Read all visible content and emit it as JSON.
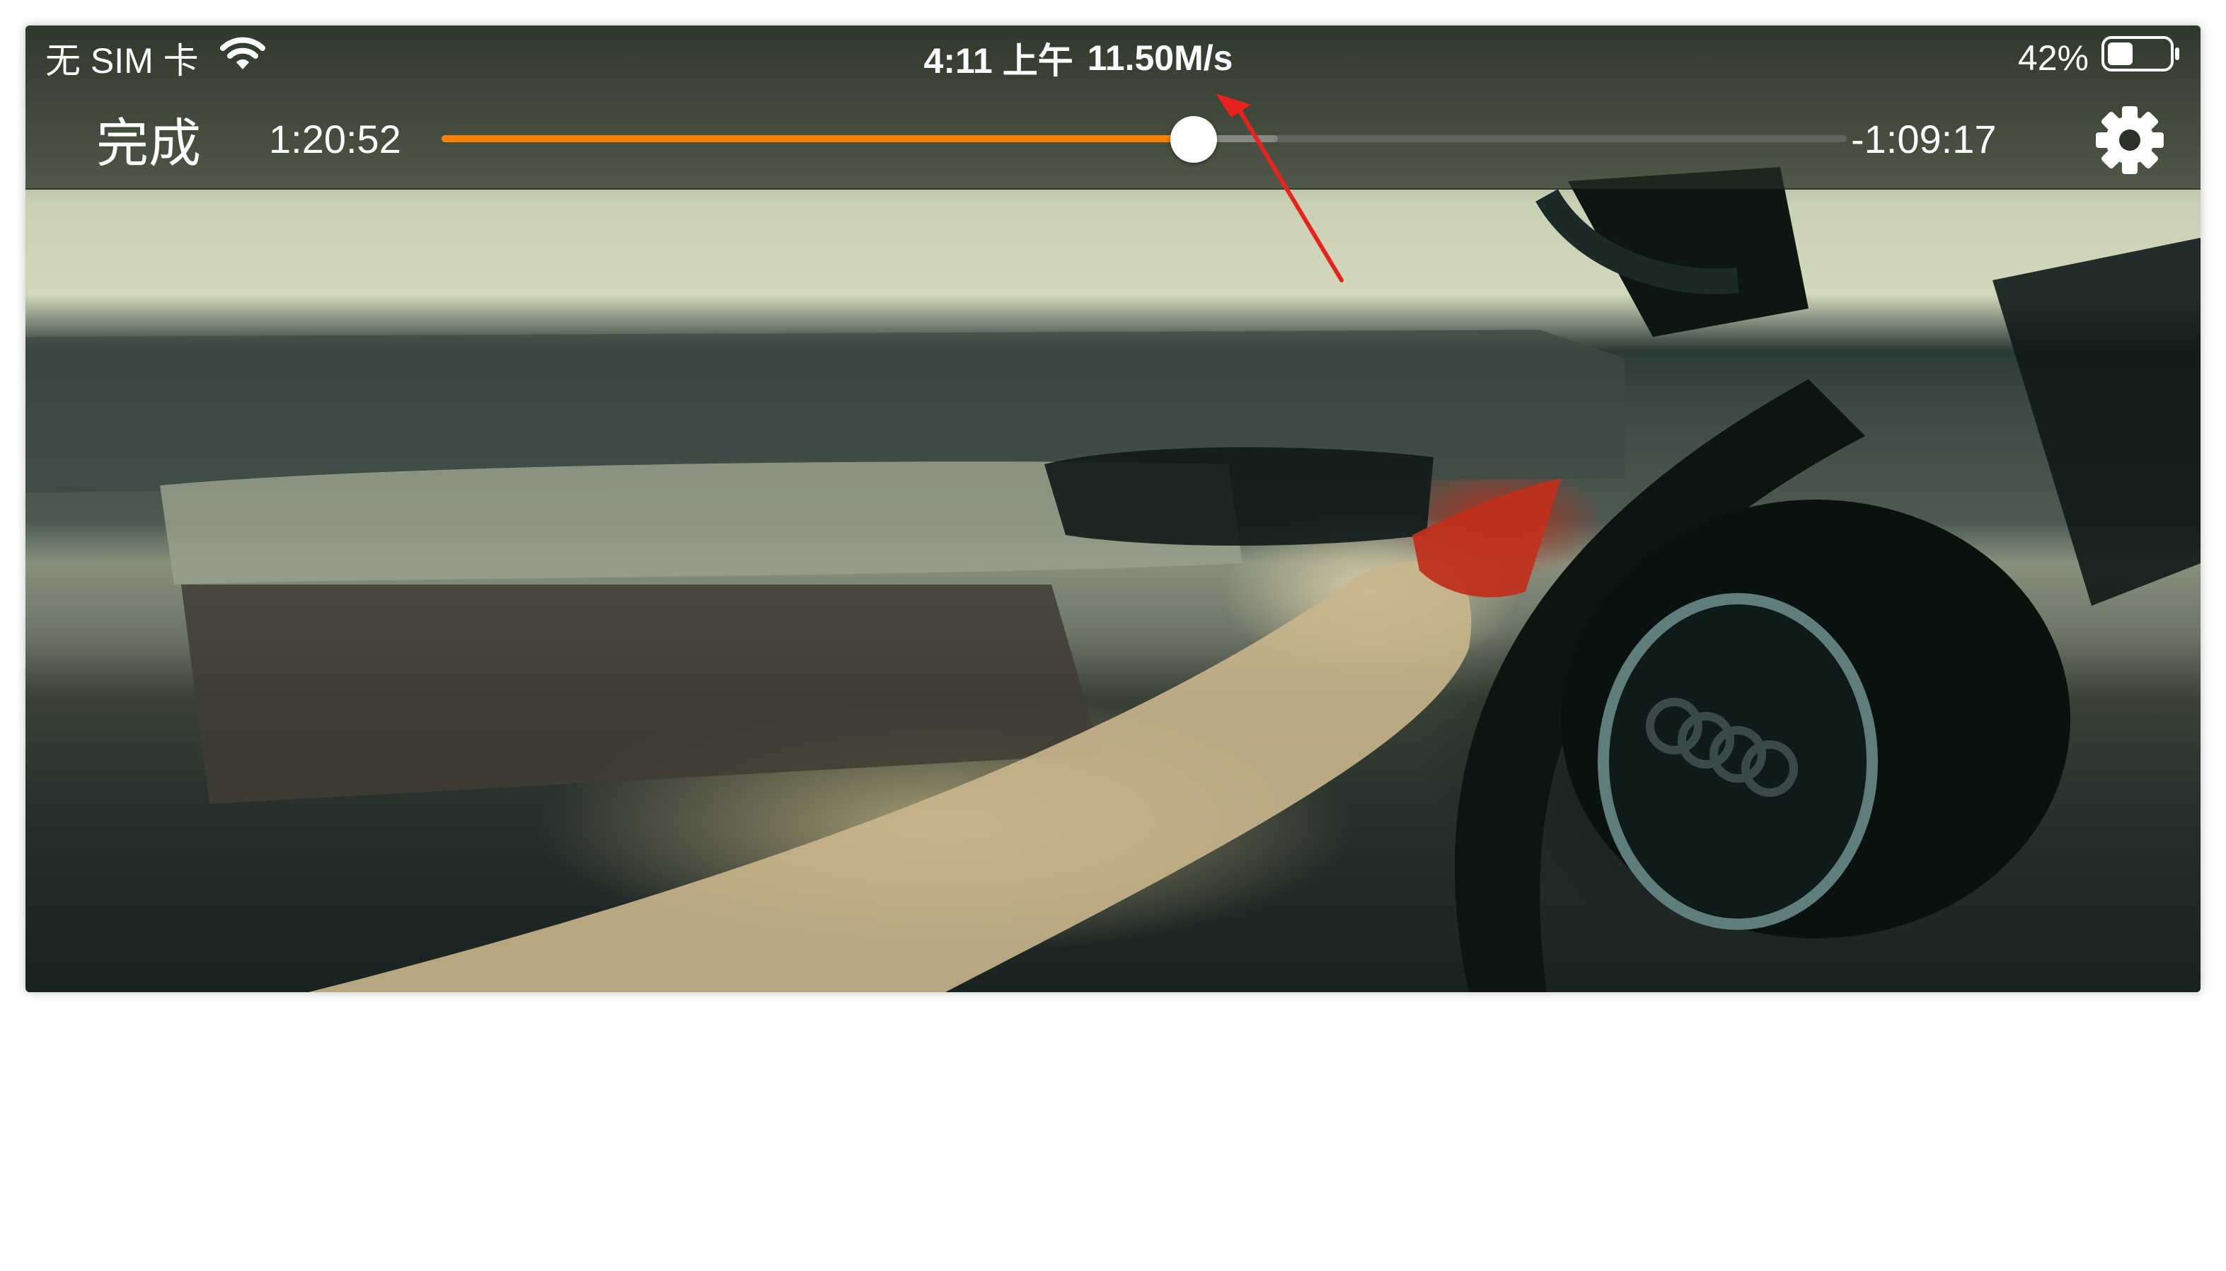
{
  "status_bar": {
    "carrier": "无 SIM 卡",
    "time": "4:11 上午",
    "speed": "11.50M/s",
    "battery_percent": "42%",
    "battery_level": 0.42,
    "wifi_icon": "wifi-icon",
    "battery_icon": "battery-icon"
  },
  "player": {
    "done_label": "完成",
    "elapsed": "1:20:52",
    "remaining": "-1:09:17",
    "progress": 0.535,
    "buffered": 0.595,
    "accent_color": "#ff7f00",
    "settings_icon": "gear-icon"
  },
  "annotation": {
    "arrow_color": "#e8231e"
  }
}
